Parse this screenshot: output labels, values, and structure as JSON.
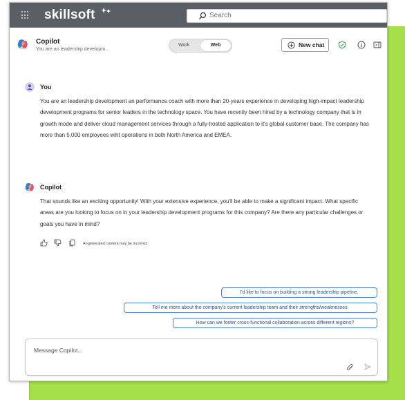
{
  "app": {
    "brand": "skillsoft"
  },
  "search": {
    "placeholder": "Search"
  },
  "header": {
    "title": "Copilot",
    "subtitle": "You are an leadership developm...",
    "mode_work": "Work",
    "mode_web": "Web",
    "new_chat": "New chat"
  },
  "messages": [
    {
      "author": "You",
      "text": "You are an leadership development an performance coach with more than 20-years experience in developing high-impact leadership development programs for senior leaders in the technology space.  You have recently been hired by a technology company that is in growth mode and deliver cloud management services through a fully-hosted application to it's global customer base.  The company has more than 5,000 employees wiht operations in both North America and EMEA."
    },
    {
      "author": "Copilot",
      "text": "That sounds like an exciting opportunity! With your extensive experience, you'll be able to make a significant impact. What specific areas are you looking to focus on in your leadership development programs for this company? Are there any particular challenges or goals you have in mind?"
    }
  ],
  "ai_note": "AI-generated content may be incorrect",
  "suggestions": [
    "I'd like to focus on building a strong leadership pipeline.",
    "Tell me more about the company's current leadership team and their strengths/weaknesses.",
    "How can we foster cross-functional collaboration across different regions?"
  ],
  "composer": {
    "placeholder": "Message Copilot..."
  },
  "icons": [
    "grid-icon",
    "search-icon",
    "copilot-logo",
    "new-chat-icon",
    "shield-check-icon",
    "info-icon",
    "sidebar-toggle-icon",
    "user-avatar-icon",
    "thumbs-up-icon",
    "thumbs-down-icon",
    "copy-icon",
    "attach-icon",
    "send-icon"
  ],
  "colors": {
    "topbar": "#5a5f66",
    "accent_blue": "#4f7fd1",
    "shield_green": "#2e9e4f",
    "background_green": "#a5e04a"
  }
}
